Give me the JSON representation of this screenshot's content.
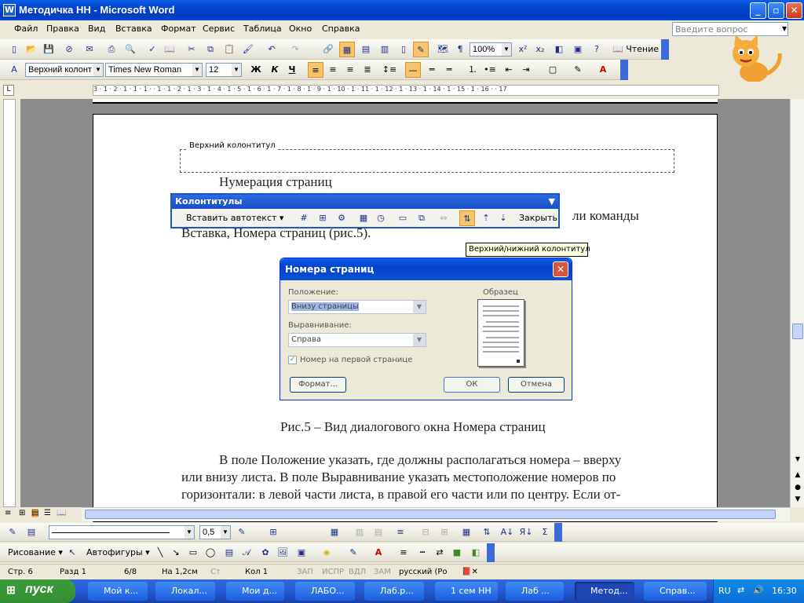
{
  "window": {
    "title": "Методичка НН - Microsoft Word"
  },
  "menu": [
    "Файл",
    "Правка",
    "Вид",
    "Вставка",
    "Формат",
    "Сервис",
    "Таблица",
    "Окно",
    "Справка"
  ],
  "ask_placeholder": "Введите вопрос",
  "standard_toolbar": {
    "zoom": "100%",
    "reading": "Чтение"
  },
  "format_toolbar": {
    "style": "Верхний колонт",
    "font": "Times New Roman",
    "size": "12"
  },
  "ruler_text": "3 · 1 · 2 · 1 · 1 · 1 · · 1 · 1 · 2 · 1 · 3 · 1 · 4 · 1 · 5 · 1 · 6 · 1 · 7 · 1 · 8 · 1 · 9 · 1 · 10 · 1 · 11 · 1 · 12 · 1 · 13 · 1 · 14 · 1 · 15 · 1 · 16 · · 17",
  "document": {
    "header_label": "Верхний колонтитул",
    "heading": "Нумерация страниц",
    "line_cmd": "ли команды",
    "line2": "Вставка, Номера страниц (рис.5).",
    "caption": "Рис.5 – Вид диалогового окна Номера страниц",
    "para1": "В поле Положение указать, где должны располагаться номера – вверху",
    "para2": "или внизу листа. В поле Выравнивание указать местоположение номеров по",
    "para3": "горизонтали: в левой части листа, в правой его части или по центру. Если от-"
  },
  "hf_toolbar": {
    "title": "Колонтитулы",
    "insert_autotext": "Вставить автотекст ▾",
    "close": "Закрыть",
    "tooltip": "Верхний/нижний колонтитул"
  },
  "dialog": {
    "title": "Номера страниц",
    "position_label": "Положение:",
    "position_value": "Внизу страницы",
    "align_label": "Выравнивание:",
    "align_value": "Справа",
    "first_page": "Номер на первой странице",
    "sample": "Образец",
    "format": "Формат...",
    "ok": "ОК",
    "cancel": "Отмена"
  },
  "drawing": {
    "drawing": "Рисование ▾",
    "autoshapes": "Автофигуры ▾",
    "line_width": "0,5"
  },
  "status": {
    "page": "Стр. 6",
    "section": "Разд 1",
    "pages": "6/8",
    "at": "На 1,2см",
    "ln": "Ст",
    "col": "Кол 1",
    "rec": "ЗАП",
    "trk": "ИСПР",
    "ext": "ВДЛ",
    "ovr": "ЗАМ",
    "lang": "русский (Ро"
  },
  "taskbar": {
    "start": "пуск",
    "tasks": [
      "Мой к...",
      "Локал...",
      "Мои д...",
      "ЛАБО...",
      "Лаб.р...",
      "1 сем НН",
      "Лаб ...",
      "Метод...",
      "Справ..."
    ],
    "lang": "RU",
    "time": "16:30"
  }
}
